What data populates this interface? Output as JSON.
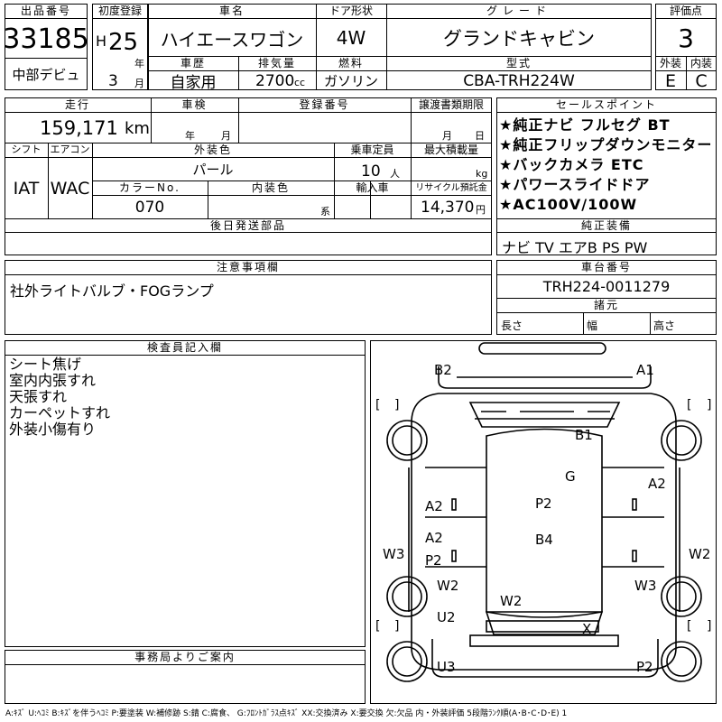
{
  "header": {
    "lot_label": "出品番号",
    "lot_number": "33185",
    "first_reg_label": "初度登録",
    "era_letter": "H",
    "year": "25",
    "year_unit": "年",
    "month": "3",
    "month_unit": "月",
    "model_label": "車名",
    "model_name": "ハイエースワゴン",
    "door_label": "ドア形状",
    "door_value": "4W",
    "grade_label": "グレード",
    "grade_value": "グランドキャビン",
    "score_label": "評価点",
    "score_value": "3",
    "debut_label": "中部デビュ",
    "history_label": "車歴",
    "history_value": "自家用",
    "displacement_label": "排気量",
    "displacement_value": "2700",
    "displacement_unit": "cc",
    "fuel_label": "燃料",
    "fuel_value": "ガソリン",
    "type_label": "型式",
    "type_value": "CBA-TRH224W",
    "exterior_grade_label": "外装",
    "exterior_grade_value": "E",
    "interior_grade_label": "内装",
    "interior_grade_value": "C"
  },
  "details": {
    "mileage_label": "走行",
    "mileage_value": "159,171",
    "mileage_unit": "km",
    "inspection_label": "車検",
    "inspection_year_unit": "年",
    "inspection_month_unit": "月",
    "registration_label": "登録番号",
    "transfer_label": "譲渡書類期限",
    "transfer_month_unit": "月",
    "transfer_day_unit": "日",
    "shift_label": "シフト",
    "shift_value": "IAT",
    "ac_label": "エアコン",
    "ac_value": "WAC",
    "exterior_color_label": "外装色",
    "exterior_color_value": "パール",
    "capacity_label": "乗車定員",
    "capacity_value": "10",
    "capacity_unit": "人",
    "max_load_label": "最大積載量",
    "max_load_unit": "kg",
    "color_no_label": "カラーNo.",
    "color_no_value": "070",
    "interior_color_label": "内装色",
    "interior_color_suffix": "系",
    "import_label": "輸入車",
    "recycle_label": "リサイクル預託金",
    "recycle_value": "14,370",
    "recycle_unit": "円",
    "later_parts_label": "後日発送部品"
  },
  "sales_points": {
    "label": "セールスポイント",
    "items": [
      "★純正ナビ フルセグ BT",
      "★純正フリップダウンモニター",
      "★バックカメラ ETC",
      "★パワースライドドア",
      "★AC100V/100W"
    ]
  },
  "factory_equipment": {
    "label": "純正装備",
    "value": "ナビ TV エアB PS PW"
  },
  "notes": {
    "label": "注意事項欄",
    "value": "社外ライトバルブ・FOGランプ"
  },
  "chassis": {
    "label": "車台番号",
    "value": "TRH224-0011279",
    "dims_label": "諸元",
    "length_label": "長さ",
    "width_label": "幅",
    "height_label": "高さ"
  },
  "inspector": {
    "label": "検査員記入欄",
    "lines": [
      "シート焦げ",
      "室内内張すれ",
      "天張すれ",
      "カーペットすれ",
      "外装小傷有り"
    ]
  },
  "office": {
    "label": "事務局よりご案内"
  },
  "diagram": {
    "marks": {
      "b2_top": "B2",
      "a1_top": "A1",
      "b1": "B1",
      "g": "G",
      "a2_right": "A2",
      "a2_left1": "A2",
      "p2_center": "P2",
      "a2_left2": "A2",
      "b4": "B4",
      "p2_left": "P2",
      "w3_left": "W3",
      "w2_right": "W2",
      "w2_left": "W2",
      "w3_right": "W3",
      "w2_bottom": "W2",
      "u2": "U2",
      "x": "X",
      "u3": "U3",
      "p2_bottom": "P2"
    }
  },
  "legend": "A:ｷｽﾞ U:ﾍｺﾐ B:ｷｽﾞを伴うﾍｺﾐ P:要塗装 W:補修跡 S:錆 C:腐食、 G:ﾌﾛﾝﾄｶﾞﾗｽ点ｷｽﾞ XX:交換済み X:要交換 欠:欠品 内・外装評価 5段階ﾗﾝｸ順(A･B･C･D･E) 1"
}
